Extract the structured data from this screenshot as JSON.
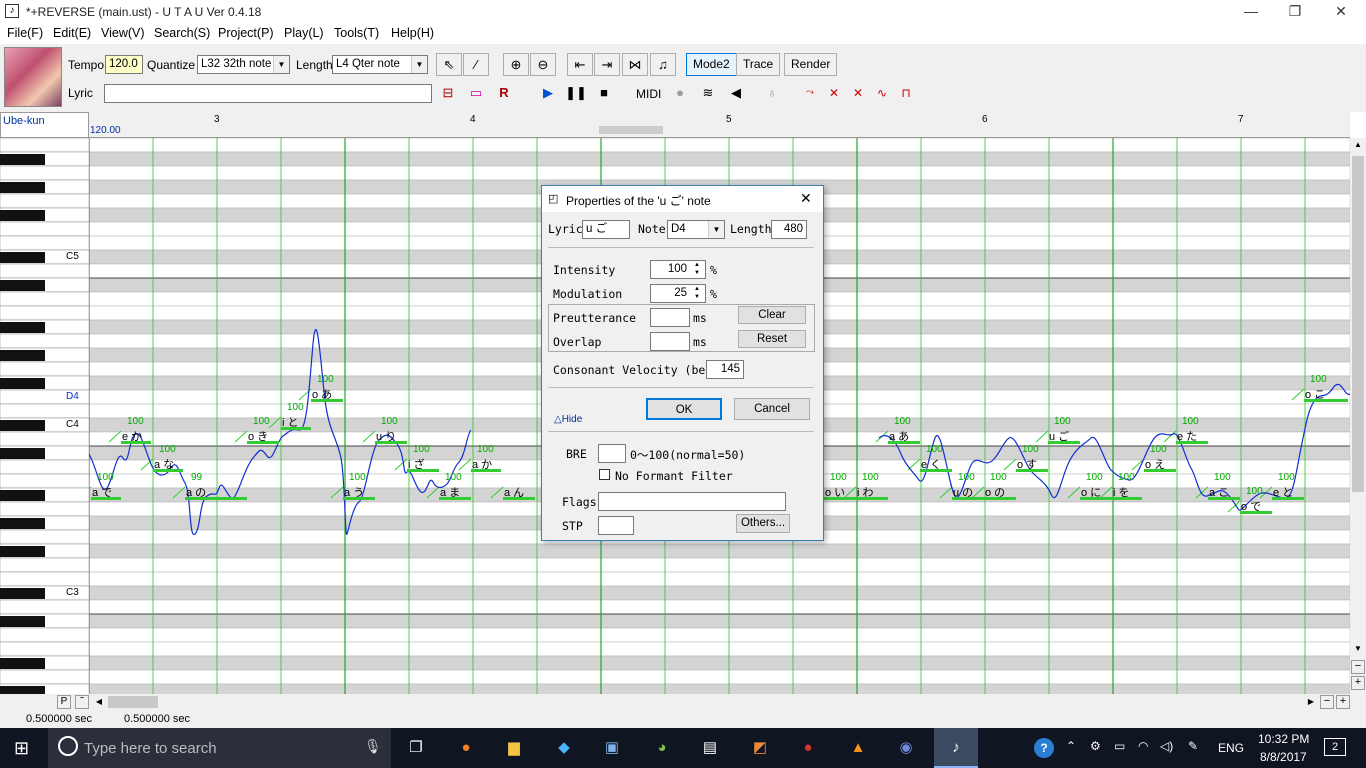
{
  "window": {
    "title": "*+REVERSE (main.ust) - U T A U Ver 0.4.18",
    "min": "—",
    "max": "❐",
    "close": "✕"
  },
  "menu": [
    "File(F)",
    "Edit(E)",
    "View(V)",
    "Search(S)",
    "Project(P)",
    "Play(L)",
    "Tools(T)",
    "Help(H)"
  ],
  "toolbar": {
    "tempo_label": "Tempo",
    "tempo_value": "120.0",
    "quantize_label": "Quantize",
    "quantize_value": "L32 32th note",
    "length_label": "Length",
    "length_value": "L4  Qter note",
    "lyric_label": "Lyric",
    "lyric_value": "",
    "mode2": "Mode2",
    "trace": "Trace",
    "render": "Render",
    "midi": "MIDI"
  },
  "roll": {
    "voicebank": "Ube-kun",
    "tempo_marker": "120.00",
    "measures": [
      "3",
      "4",
      "5",
      "6",
      "7"
    ],
    "key_labels": [
      "C5",
      "D4",
      "C4",
      "C3"
    ],
    "notes": [
      {
        "lyric": "a で",
        "vel": "100"
      },
      {
        "lyric": "e か",
        "vel": "100"
      },
      {
        "lyric": "a な",
        "vel": "100"
      },
      {
        "lyric": "a の",
        "vel": "99"
      },
      {
        "lyric": "o き",
        "vel": "100"
      },
      {
        "lyric": "i と",
        "vel": "100"
      },
      {
        "lyric": "o あ",
        "vel": "100"
      },
      {
        "lyric": "a う",
        "vel": "100"
      },
      {
        "lyric": "u り",
        "vel": "100"
      },
      {
        "lyric": "i ざ",
        "vel": "100"
      },
      {
        "lyric": "a ま",
        "vel": "100"
      },
      {
        "lyric": "a か",
        "vel": "100"
      },
      {
        "lyric": "a ん",
        "vel": ""
      },
      {
        "lyric": "o い",
        "vel": "100"
      },
      {
        "lyric": "i わ",
        "vel": "100"
      },
      {
        "lyric": "a あ",
        "vel": "100"
      },
      {
        "lyric": "e く",
        "vel": "100"
      },
      {
        "lyric": "u の",
        "vel": "100"
      },
      {
        "lyric": "o の",
        "vel": "100"
      },
      {
        "lyric": "o す",
        "vel": "100"
      },
      {
        "lyric": "u ご",
        "vel": "100"
      },
      {
        "lyric": "o に",
        "vel": "100"
      },
      {
        "lyric": "i を",
        "vel": "100"
      },
      {
        "lyric": "o え",
        "vel": "100"
      },
      {
        "lyric": "e た",
        "vel": "100"
      },
      {
        "lyric": "a こ",
        "vel": "100"
      },
      {
        "lyric": "o で",
        "vel": "100"
      },
      {
        "lyric": "e と",
        "vel": "100"
      },
      {
        "lyric": "o こ",
        "vel": "100"
      }
    ]
  },
  "dialog": {
    "title": "Properties of the 'u ご' note",
    "lyric_label": "Lyric",
    "lyric_value": "u ご",
    "note_label": "Note",
    "note_value": "D4",
    "length_label": "Length",
    "length_value": "480",
    "intensity_label": "Intensity",
    "intensity_value": "100",
    "percent": "%",
    "modulation_label": "Modulation",
    "modulation_value": "25",
    "preutterance_label": "Preutterance",
    "ms": "ms",
    "overlap_label": "Overlap",
    "clear": "Clear",
    "reset": "Reset",
    "velocity_label": "Consonant Velocity (beta)",
    "velocity_value": "145",
    "ok": "OK",
    "cancel": "Cancel",
    "hide": "△Hide",
    "bre_label": "BRE",
    "bre_hint": "0～100(normal=50)",
    "noformant_label": "No Formant Filter",
    "flags_label": "Flags",
    "stp_label": "STP",
    "others": "Others..."
  },
  "status": {
    "left": "0.500000 sec",
    "right": "0.500000 sec"
  },
  "taskbar": {
    "search_placeholder": "Type here to search",
    "lang": "ENG",
    "time": "10:32 PM",
    "date": "8/8/2017",
    "notif": "2"
  }
}
